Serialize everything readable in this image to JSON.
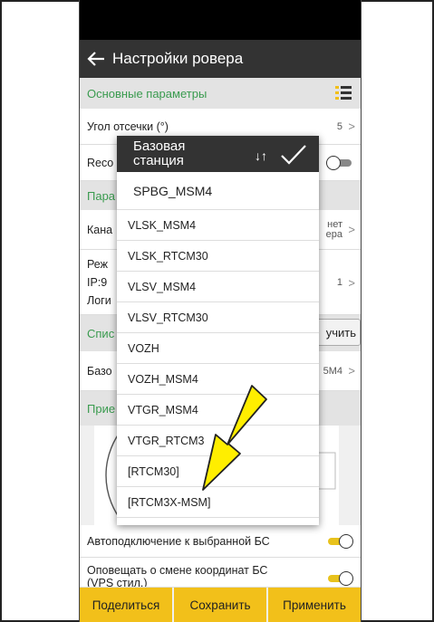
{
  "app": {
    "title": "Настройки ровера"
  },
  "sections": {
    "main": "Основные параметры",
    "params": "Пара",
    "list": "Спис",
    "receive": "Прие"
  },
  "settings": {
    "cutoff_label": "Угол отсечки (°)",
    "cutoff_value": "5",
    "record_label": "Reco",
    "channel_label": "Кана",
    "channel_value": "нет\nера",
    "mode_label": "Реж",
    "ip_label": "IP:9",
    "ip_value": "1",
    "login_label": "Логи",
    "get_button": "учить",
    "base_label": "Базо",
    "base_value": "5M4",
    "autoconnect_label": "Автоподключение к выбранной БС",
    "notify_label": "Оповещать о смене координат БС",
    "notify_sub": "(VPS стил.)"
  },
  "dialog": {
    "title": "Базовая станция",
    "sort_icon": "sort-arrows-icon",
    "confirm_icon": "checkmark-icon",
    "options": [
      "SPBG_MSM4",
      "VLSK_MSM4",
      "VLSK_RTCM30",
      "VLSV_MSM4",
      "VLSV_RTCM30",
      "VOZH",
      "VOZH_MSM4",
      "VTGR_MSM4",
      "VTGR_RTCM3",
      "[RTCM30]",
      "[RTCM3X-MSM]"
    ]
  },
  "bottom": {
    "share": "Поделиться",
    "save": "Сохранить",
    "apply": "Применить"
  },
  "colors": {
    "accent": "#f2c01a",
    "section_text": "#3a9b4f",
    "arrow": "#ffee00"
  }
}
